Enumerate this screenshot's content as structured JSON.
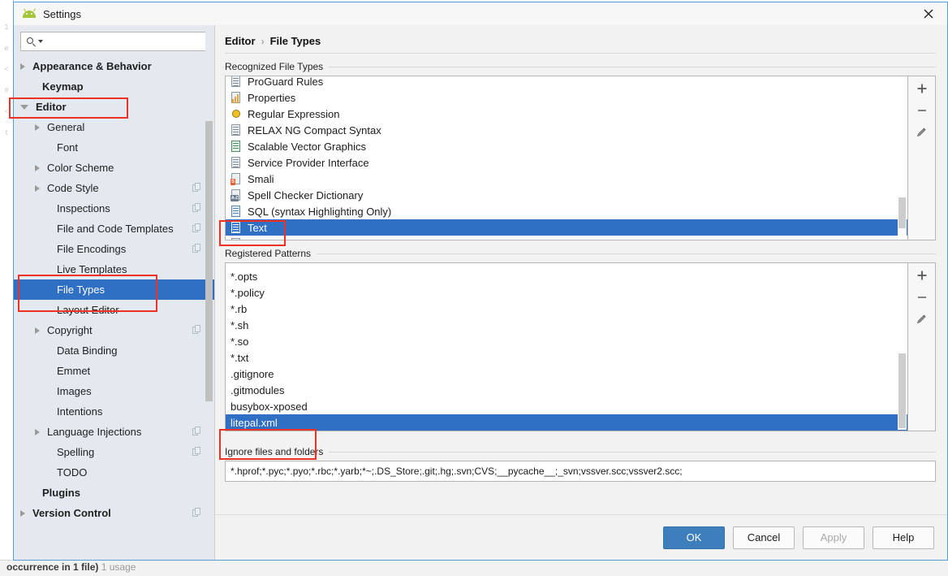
{
  "ide": {
    "left_glyphs": [
      "1",
      "e",
      "<",
      "#",
      "<",
      "t"
    ],
    "statusbar_text": "occurrence in 1 file)",
    "statusbar_dim": "1 usage"
  },
  "window": {
    "title": "Settings",
    "app_icon": "android-icon",
    "close_icon": "close-icon"
  },
  "sidebar": {
    "search": {
      "value": "",
      "placeholder": "",
      "icon": "search-icon",
      "caret": "chevron-down-icon"
    },
    "items": [
      {
        "label": "Appearance & Behavior",
        "indent": 8,
        "arrow": "closed",
        "bold": true,
        "copy": false,
        "selected": false
      },
      {
        "label": "Keymap",
        "indent": 26,
        "arrow": "none",
        "bold": true,
        "copy": false,
        "selected": false
      },
      {
        "label": "Editor",
        "indent": 8,
        "arrow": "open",
        "bold": true,
        "copy": false,
        "selected": false
      },
      {
        "label": "General",
        "indent": 26,
        "arrow": "closed",
        "bold": false,
        "copy": false,
        "selected": false
      },
      {
        "label": "Font",
        "indent": 44,
        "arrow": "none",
        "bold": false,
        "copy": false,
        "selected": false
      },
      {
        "label": "Color Scheme",
        "indent": 26,
        "arrow": "closed",
        "bold": false,
        "copy": false,
        "selected": false
      },
      {
        "label": "Code Style",
        "indent": 26,
        "arrow": "closed",
        "bold": false,
        "copy": true,
        "selected": false
      },
      {
        "label": "Inspections",
        "indent": 44,
        "arrow": "none",
        "bold": false,
        "copy": true,
        "selected": false
      },
      {
        "label": "File and Code Templates",
        "indent": 44,
        "arrow": "none",
        "bold": false,
        "copy": true,
        "selected": false
      },
      {
        "label": "File Encodings",
        "indent": 44,
        "arrow": "none",
        "bold": false,
        "copy": true,
        "selected": false
      },
      {
        "label": "Live Templates",
        "indent": 44,
        "arrow": "none",
        "bold": false,
        "copy": false,
        "selected": false
      },
      {
        "label": "File Types",
        "indent": 44,
        "arrow": "none",
        "bold": false,
        "copy": false,
        "selected": true
      },
      {
        "label": "Layout Editor",
        "indent": 44,
        "arrow": "none",
        "bold": false,
        "copy": false,
        "selected": false
      },
      {
        "label": "Copyright",
        "indent": 26,
        "arrow": "closed",
        "bold": false,
        "copy": true,
        "selected": false
      },
      {
        "label": "Data Binding",
        "indent": 44,
        "arrow": "none",
        "bold": false,
        "copy": false,
        "selected": false
      },
      {
        "label": "Emmet",
        "indent": 44,
        "arrow": "none",
        "bold": false,
        "copy": false,
        "selected": false
      },
      {
        "label": "Images",
        "indent": 44,
        "arrow": "none",
        "bold": false,
        "copy": false,
        "selected": false
      },
      {
        "label": "Intentions",
        "indent": 44,
        "arrow": "none",
        "bold": false,
        "copy": false,
        "selected": false
      },
      {
        "label": "Language Injections",
        "indent": 26,
        "arrow": "closed",
        "bold": false,
        "copy": true,
        "selected": false
      },
      {
        "label": "Spelling",
        "indent": 44,
        "arrow": "none",
        "bold": false,
        "copy": true,
        "selected": false
      },
      {
        "label": "TODO",
        "indent": 44,
        "arrow": "none",
        "bold": false,
        "copy": false,
        "selected": false
      },
      {
        "label": "Plugins",
        "indent": 26,
        "arrow": "none",
        "bold": true,
        "copy": false,
        "selected": false
      },
      {
        "label": "Version Control",
        "indent": 8,
        "arrow": "closed",
        "bold": true,
        "copy": true,
        "selected": false
      }
    ]
  },
  "main": {
    "breadcrumb": {
      "parent": "Editor",
      "separator": "›",
      "current": "File Types"
    },
    "recognized": {
      "title": "Recognized File Types",
      "items": [
        {
          "label": "ProGuard Rules",
          "icon": "file-lines-icon",
          "selected": false
        },
        {
          "label": "Properties",
          "icon": "file-bars-icon",
          "selected": false
        },
        {
          "label": "Regular Expression",
          "icon": "regex-gear-icon",
          "selected": false
        },
        {
          "label": "RELAX NG Compact Syntax",
          "icon": "file-lines-icon",
          "selected": false
        },
        {
          "label": "Scalable Vector Graphics",
          "icon": "file-svg-icon",
          "selected": false
        },
        {
          "label": "Service Provider Interface",
          "icon": "file-lines-icon",
          "selected": false
        },
        {
          "label": "Smali",
          "icon": "file-smali-icon",
          "selected": false
        },
        {
          "label": "Spell Checker Dictionary",
          "icon": "file-az-icon",
          "selected": false
        },
        {
          "label": "SQL (syntax Highlighting Only)",
          "icon": "file-sql-icon",
          "selected": false
        },
        {
          "label": "Text",
          "icon": "file-text-icon",
          "selected": true
        }
      ],
      "toolbar": [
        {
          "name": "add-file-type-button",
          "icon": "plus-icon"
        },
        {
          "name": "remove-file-type-button",
          "icon": "minus-icon"
        },
        {
          "name": "edit-file-type-button",
          "icon": "pencil-icon"
        }
      ]
    },
    "patterns": {
      "title": "Registered Patterns",
      "items": [
        {
          "label": "*.opts",
          "selected": false
        },
        {
          "label": "*.policy",
          "selected": false
        },
        {
          "label": "*.rb",
          "selected": false
        },
        {
          "label": "*.sh",
          "selected": false
        },
        {
          "label": "*.so",
          "selected": false
        },
        {
          "label": "*.txt",
          "selected": false
        },
        {
          "label": ".gitignore",
          "selected": false
        },
        {
          "label": ".gitmodules",
          "selected": false
        },
        {
          "label": "busybox-xposed",
          "selected": false
        },
        {
          "label": "litepal.xml",
          "selected": true
        }
      ],
      "toolbar": [
        {
          "name": "add-pattern-button",
          "icon": "plus-icon"
        },
        {
          "name": "remove-pattern-button",
          "icon": "minus-icon"
        },
        {
          "name": "edit-pattern-button",
          "icon": "pencil-icon"
        }
      ]
    },
    "ignore": {
      "label": "Ignore files and folders",
      "value": "*.hprof;*.pyc;*.pyo;*.rbc;*.yarb;*~;.DS_Store;.git;.hg;.svn;CVS;__pycache__;_svn;vssver.scc;vssver2.scc;",
      "placeholder": ""
    }
  },
  "footer": {
    "ok": "OK",
    "cancel": "Cancel",
    "apply": "Apply",
    "help": "Help"
  },
  "colors": {
    "selection_blue": "#2f6fc4",
    "primary_button": "#3d7ebd",
    "annotation_red": "#ee3124",
    "dialog_border": "#5b9bd5"
  }
}
